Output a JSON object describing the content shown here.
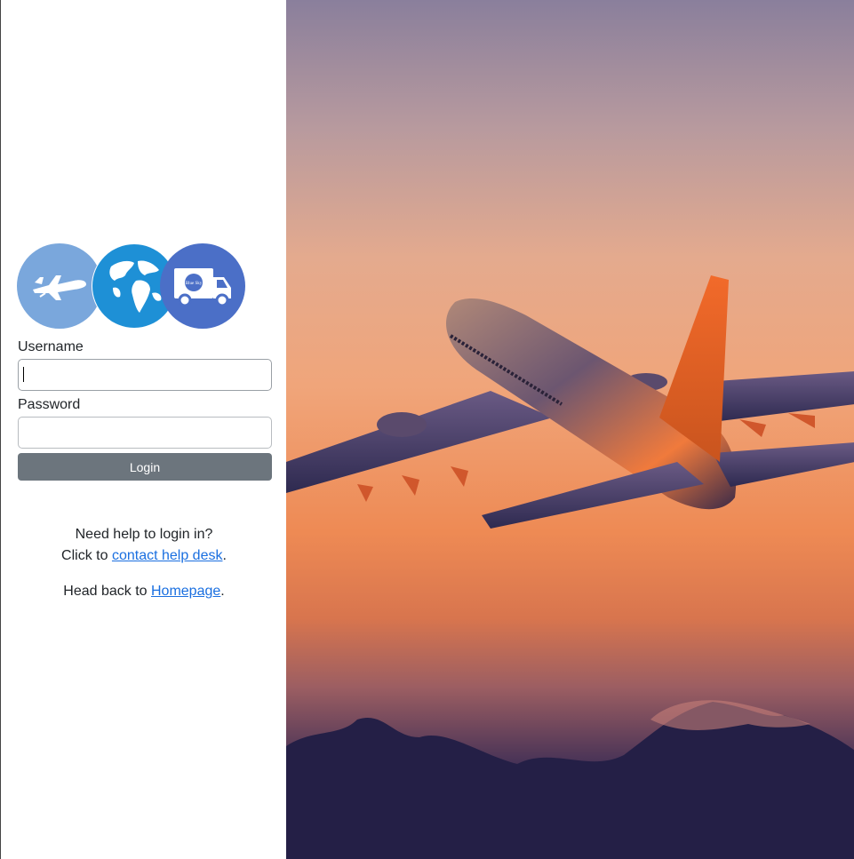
{
  "login_form": {
    "username_label": "Username",
    "username_value": "",
    "password_label": "Password",
    "password_value": "",
    "login_button": "Login"
  },
  "help": {
    "question": "Need help to login in?",
    "contact_prefix": "Click to ",
    "contact_link": "contact help desk",
    "contact_suffix": ".",
    "homepage_prefix": "Head back to ",
    "homepage_link": "Homepage",
    "homepage_suffix": "."
  },
  "logo": {
    "icons": [
      "airplane-icon",
      "globe-icon",
      "delivery-truck-icon"
    ],
    "truck_badge_text": "Blue Sky"
  },
  "colors": {
    "button_bg": "#6c757d",
    "link": "#1a6fe0",
    "logo_plane_bg": "#7aa7dc",
    "logo_globe": "#1e90d6",
    "logo_truck_bg": "#4b6fc7"
  }
}
